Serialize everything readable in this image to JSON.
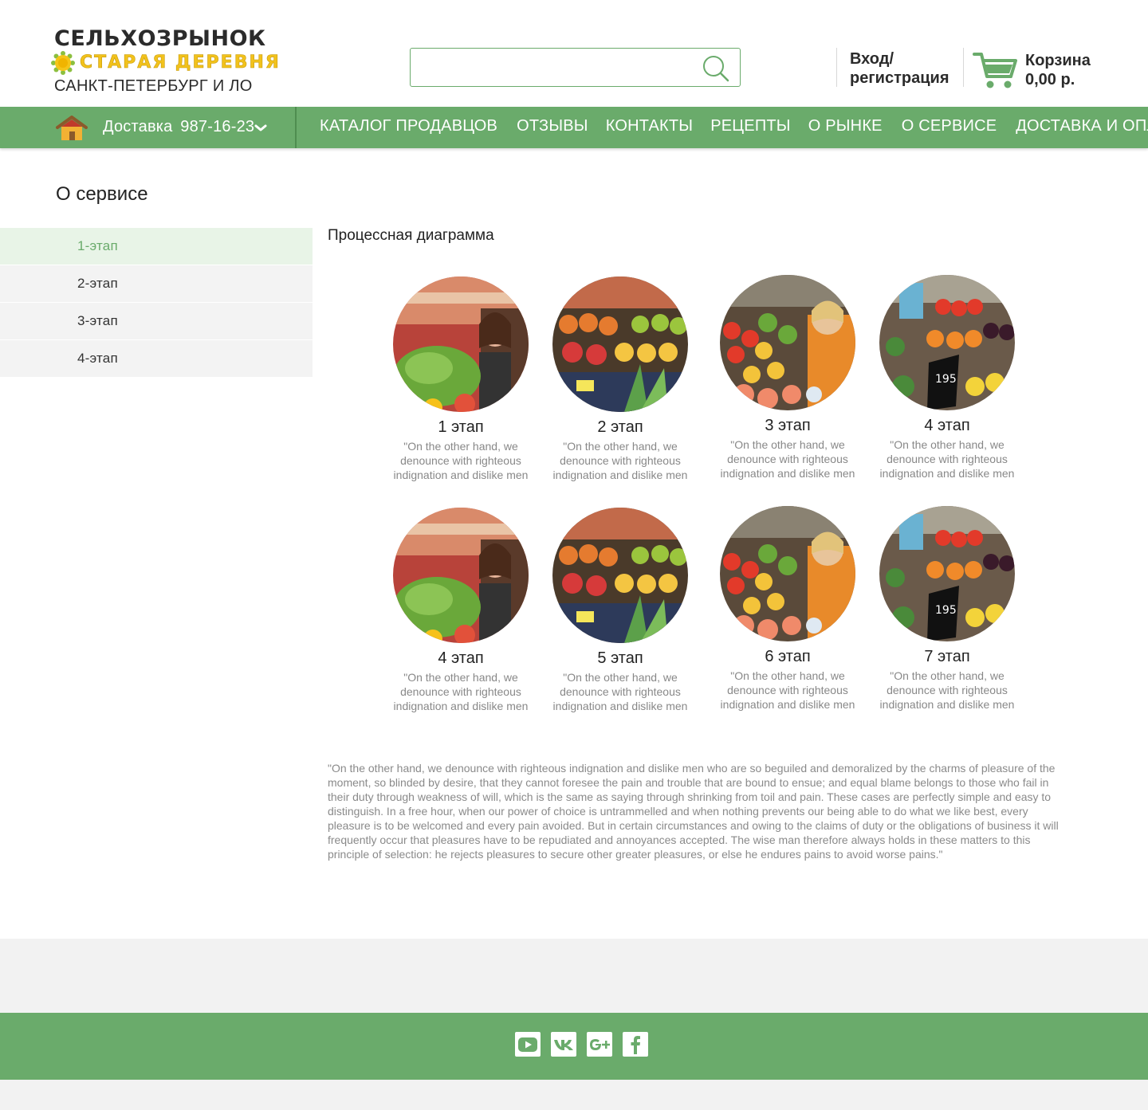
{
  "header": {
    "logo_line1": "СЕЛЬХОЗРЫНОК",
    "logo_line2": "СТАРАЯ ДЕРЕВНЯ",
    "logo_line3": "САНКТ-ПЕТЕРБУРГ И ЛО",
    "search": {
      "value": "",
      "placeholder": ""
    },
    "login_line1": "Вход/",
    "login_line2": "регистрация",
    "cart_label": "Корзина",
    "cart_total": "0,00 р."
  },
  "nav": {
    "delivery_label": "Доставка",
    "delivery_phone": "987-16-23",
    "menu": [
      "КАТАЛОГ ПРОДАВЦОВ",
      "ОТЗЫВЫ",
      "КОНТАКТЫ",
      "РЕЦЕПТЫ",
      "О РЫНКЕ",
      "О СЕРВИСЕ",
      "ДОСТАВКА И ОПЛАТА"
    ]
  },
  "page": {
    "title": "О сервисе",
    "sidebar": [
      {
        "label": "1-этап",
        "active": true
      },
      {
        "label": "2-этап",
        "active": false
      },
      {
        "label": "3-этап",
        "active": false
      },
      {
        "label": "4-этап",
        "active": false
      }
    ],
    "content_title": "Процессная диаграмма",
    "steps": [
      {
        "label": "1 этап",
        "desc": "\"On the other hand, we denounce with righteous indignation and dislike men who",
        "image": "market-woman-greens"
      },
      {
        "label": "2 этап",
        "desc": "\"On the other hand, we denounce with righteous indignation and dislike men who",
        "image": "market-fruit-stall"
      },
      {
        "label": "3 этап",
        "desc": "\"On the other hand, we denounce with righteous indignation and dislike men who",
        "image": "market-vendor-vegetables"
      },
      {
        "label": "4 этап",
        "desc": "\"On the other hand, we denounce with righteous indignation and dislike men who",
        "image": "market-price-tags"
      },
      {
        "label": "4 этап",
        "desc": "\"On the other hand, we denounce with righteous indignation and dislike men who",
        "image": "market-woman-greens"
      },
      {
        "label": "5 этап",
        "desc": "\"On the other hand, we denounce with righteous indignation and dislike men who",
        "image": "market-fruit-stall"
      },
      {
        "label": "6 этап",
        "desc": "\"On the other hand, we denounce with righteous indignation and dislike men who",
        "image": "market-vendor-vegetables"
      },
      {
        "label": "7 этап",
        "desc": "\"On the other hand, we denounce with righteous indignation and dislike men who",
        "image": "market-price-tags"
      }
    ],
    "long_text": "\"On the other hand, we denounce with righteous indignation and dislike men who are so beguiled and demoralized by the charms of pleasure of the moment, so blinded by desire, that they cannot foresee the pain and trouble that are bound to ensue; and equal blame belongs to those who fail in their duty through weakness of will, which is the same as saying through shrinking from toil and pain. These cases are perfectly simple and easy to distinguish. In a free hour, when our power of choice is untrammelled and when nothing prevents our being able to do what we like best, every pleasure is to be welcomed and every pain avoided. But in certain circumstances and owing to the claims of duty or the obligations of business it will frequently occur that pleasures have to be repudiated and annoyances accepted. The wise man therefore always holds in these matters to this principle of selection: he rejects pleasures to secure other greater pleasures, or else he endures pains to avoid worse pains.\""
  },
  "footer": {
    "socials": [
      "youtube-icon",
      "vk-icon",
      "google-plus-icon",
      "facebook-icon"
    ]
  },
  "colors": {
    "brand_green": "#6aab6b",
    "nav_separator": "#4f8d50",
    "logo_yellow": "#f2c21c",
    "active_bg": "#e8f4e7",
    "sidebar_bg": "#f3f3f3",
    "footer_gray": "#f2f2f2"
  }
}
